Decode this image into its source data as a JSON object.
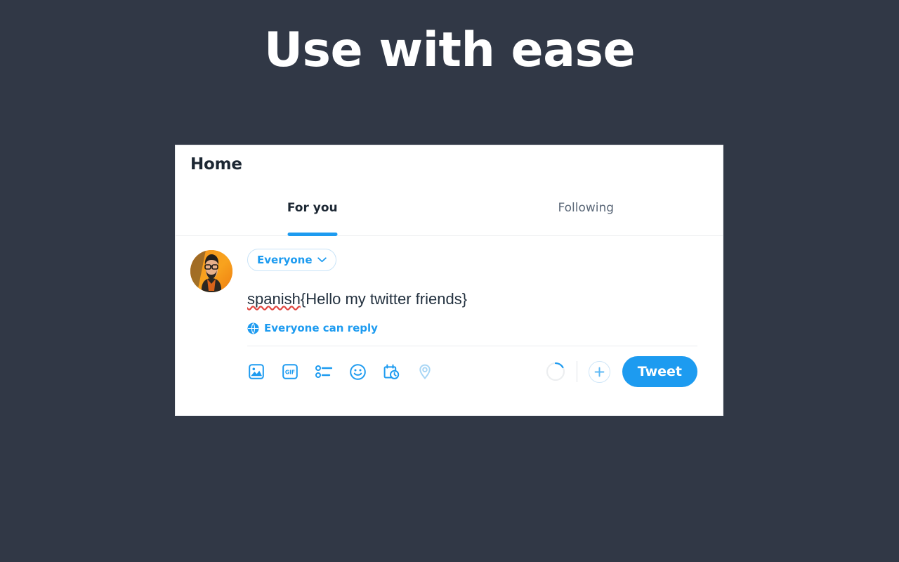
{
  "page": {
    "headline": "Use with ease",
    "background_color": "#313846",
    "accent_color": "#1d9bf0"
  },
  "card": {
    "header": {
      "title": "Home"
    },
    "tabs": [
      {
        "label": "For you",
        "active": true
      },
      {
        "label": "Following",
        "active": false
      }
    ],
    "composer": {
      "avatar": {
        "icon": "user-avatar-photo",
        "alt": "bearded man with glasses on orange background"
      },
      "audience": {
        "label": "Everyone",
        "chevron_icon": "chevron-down-icon"
      },
      "text": {
        "misspelled_word": "spanish",
        "rest": "{Hello my twitter friends}",
        "full": "spanish{Hello my twitter friends}"
      },
      "reply_scope": {
        "icon": "globe-icon",
        "label": "Everyone can reply"
      },
      "toolbar": {
        "icons": [
          {
            "name": "image-icon",
            "label": "Media"
          },
          {
            "name": "gif-icon",
            "label": "GIF"
          },
          {
            "name": "poll-icon",
            "label": "Poll"
          },
          {
            "name": "emoji-icon",
            "label": "Emoji"
          },
          {
            "name": "schedule-icon",
            "label": "Schedule"
          },
          {
            "name": "location-icon",
            "label": "Location",
            "disabled": true
          }
        ],
        "char_progress_percent": 0,
        "add-thread_icon": "plus-icon",
        "tweet_button_label": "Tweet"
      }
    }
  }
}
